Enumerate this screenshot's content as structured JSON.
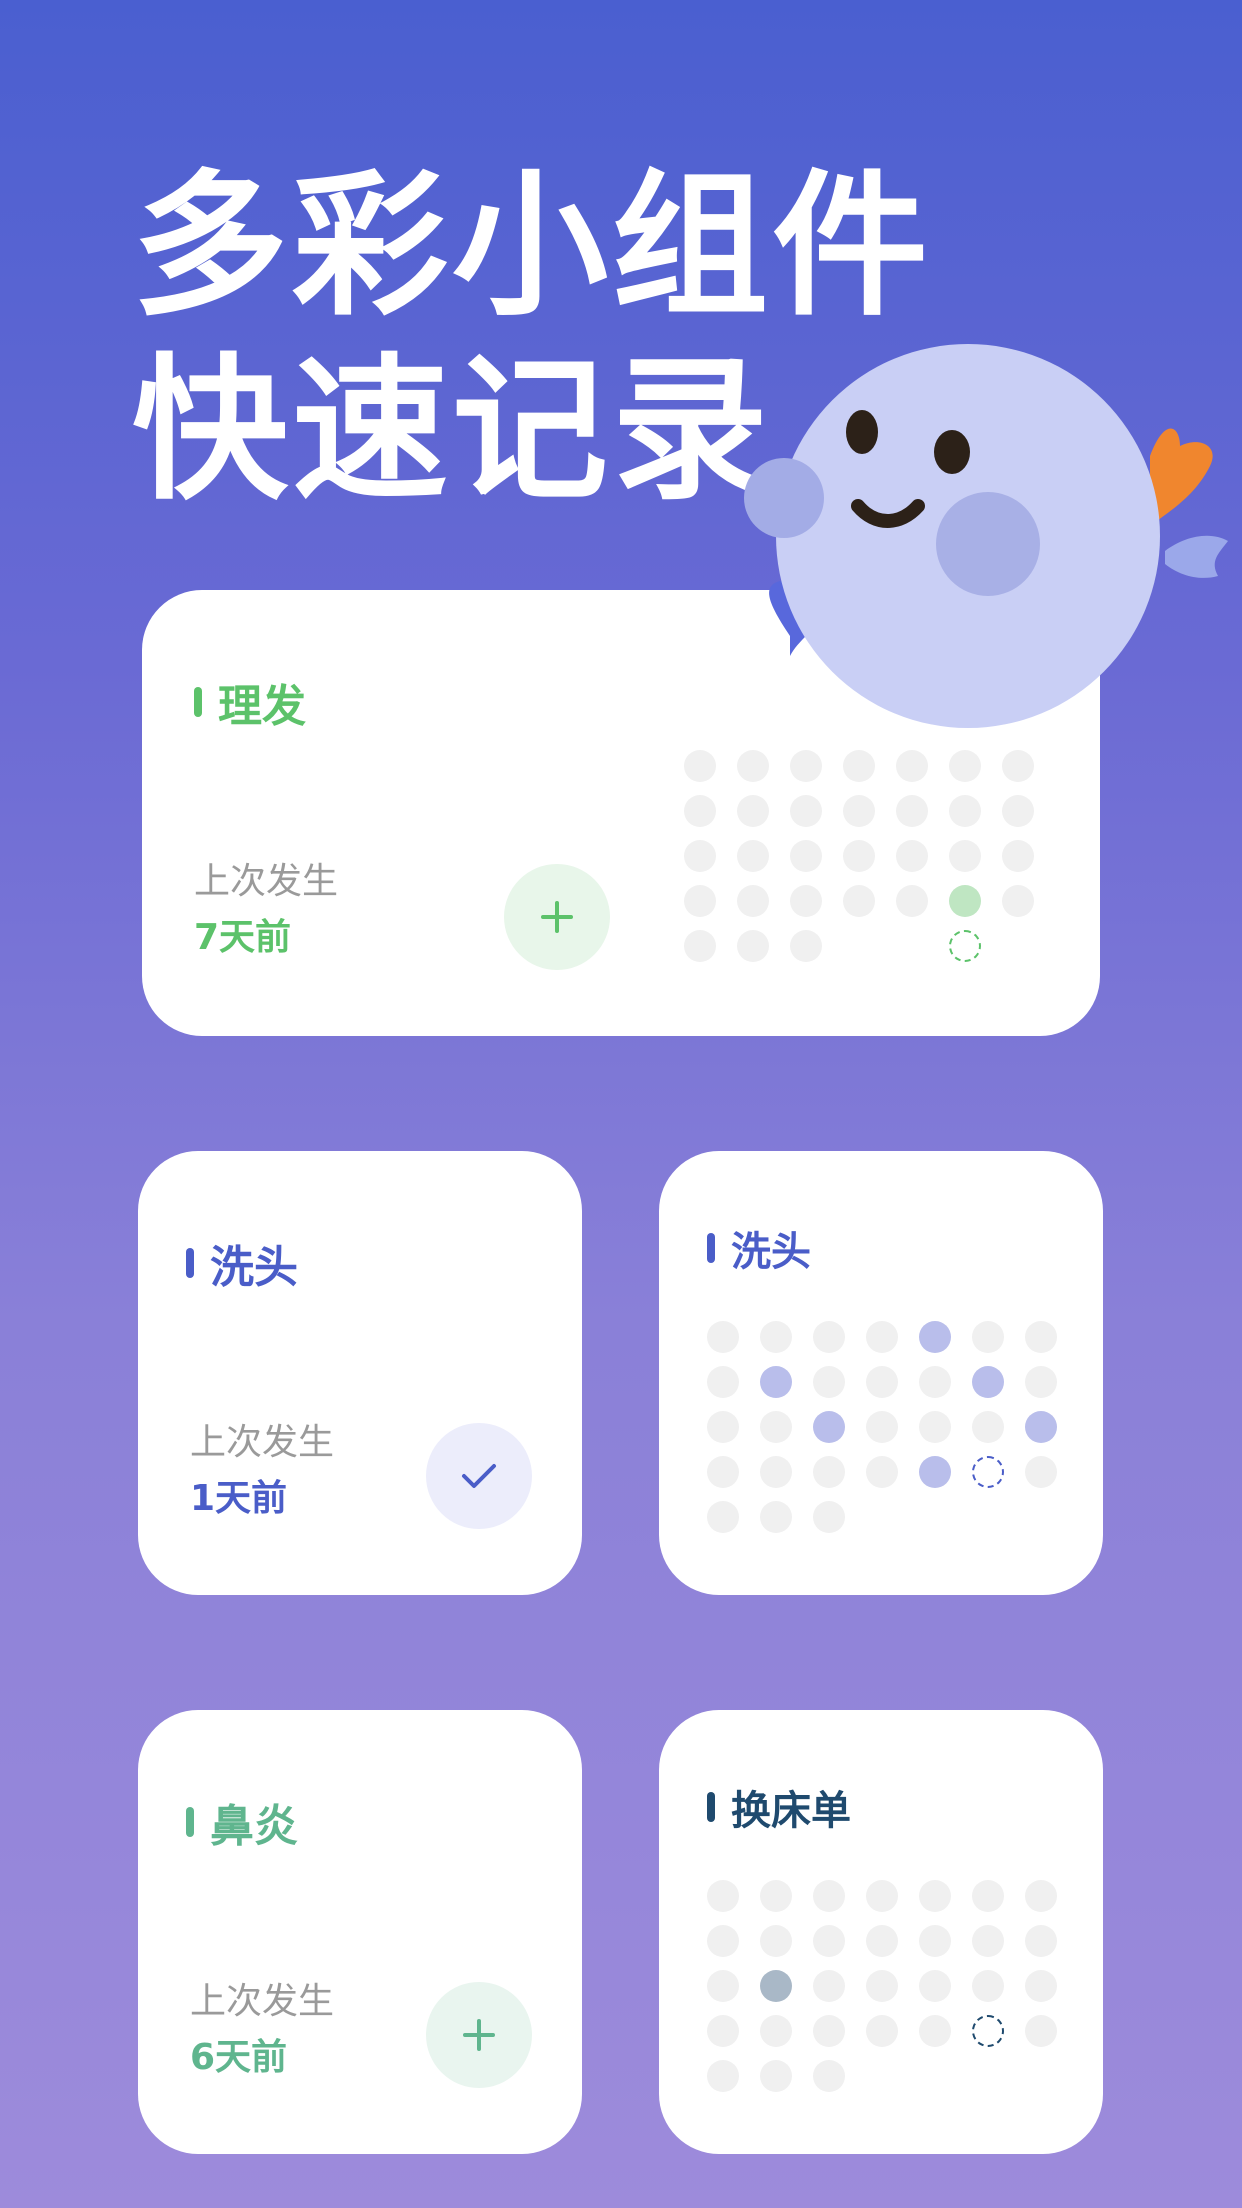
{
  "headline": {
    "line1": "多彩小组件",
    "line2": "快速记录"
  },
  "colors": {
    "green": "#5CC26A",
    "blue": "#4A5DC8",
    "teal": "#5FB58E",
    "navy": "#1F4A6E",
    "dot_empty": "#F0F0F0"
  },
  "widgets": {
    "haircut": {
      "title": "理发",
      "last_label": "上次发生",
      "last_value": "7天前",
      "action_icon": "plus-icon",
      "dots": {
        "count": 31,
        "highlighted": [
          26
        ],
        "today": 33,
        "highlight_color": "#BFE6C2",
        "today_color": "#5CC26A"
      }
    },
    "wash_small": {
      "title": "洗头",
      "last_label": "上次发生",
      "last_value": "1天前",
      "action_icon": "check-icon"
    },
    "wash_calendar": {
      "title": "洗头",
      "dots": {
        "count": 31,
        "highlighted": [
          4,
          8,
          12,
          16,
          20,
          25
        ],
        "today": 26,
        "highlight_color": "#B9BEEB",
        "today_color": "#4A5DC8"
      }
    },
    "rhinitis": {
      "title": "鼻炎",
      "last_label": "上次发生",
      "last_value": "6天前",
      "action_icon": "plus-icon"
    },
    "bedsheet_calendar": {
      "title": "换床单",
      "dots": {
        "count": 31,
        "highlighted": [
          15
        ],
        "today": 26,
        "highlight_color": "#A9B8C7",
        "today_color": "#1F4A6E"
      }
    }
  }
}
